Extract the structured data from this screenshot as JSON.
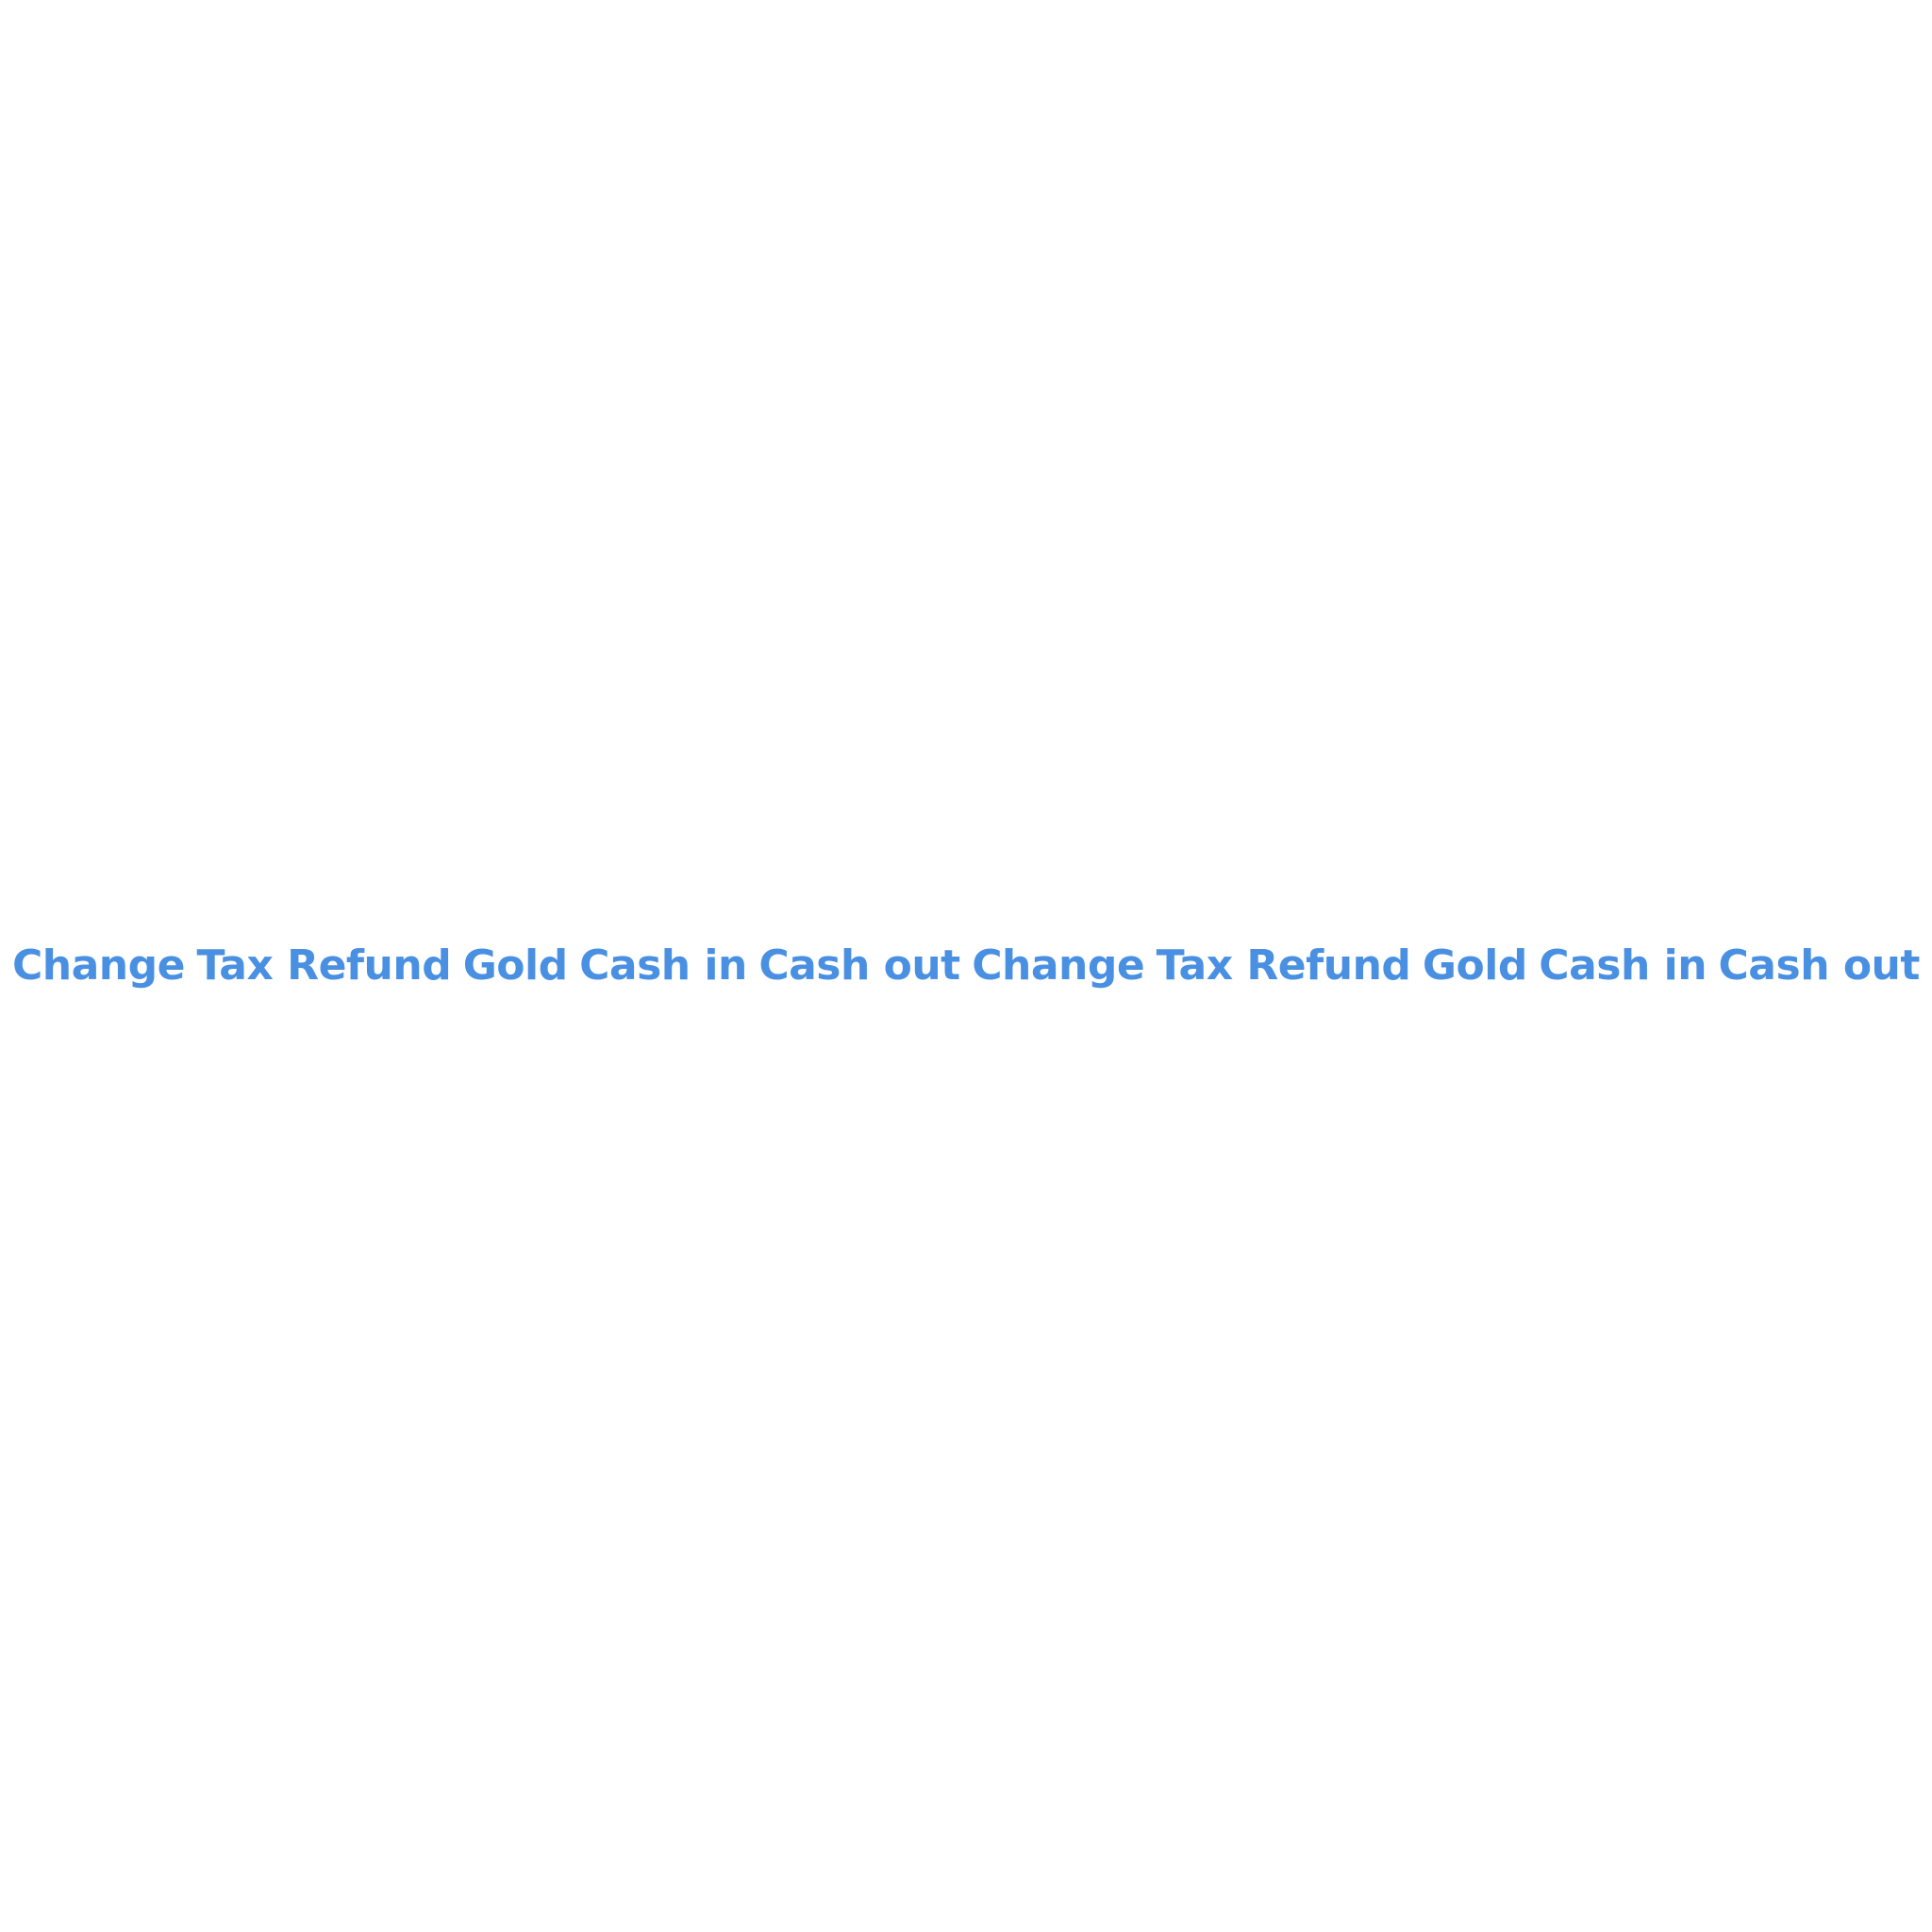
{
  "accent_color": "#4a90e2",
  "tags": [
    {
      "label": "Change"
    },
    {
      "label": "Tax Refund"
    },
    {
      "label": "Gold"
    },
    {
      "label": "Cash in"
    },
    {
      "label": "Cash out"
    },
    {
      "label": "Change"
    },
    {
      "label": "Tax Refund"
    },
    {
      "label": "Gold"
    },
    {
      "label": "Cash in"
    },
    {
      "label": "Cash out"
    }
  ]
}
